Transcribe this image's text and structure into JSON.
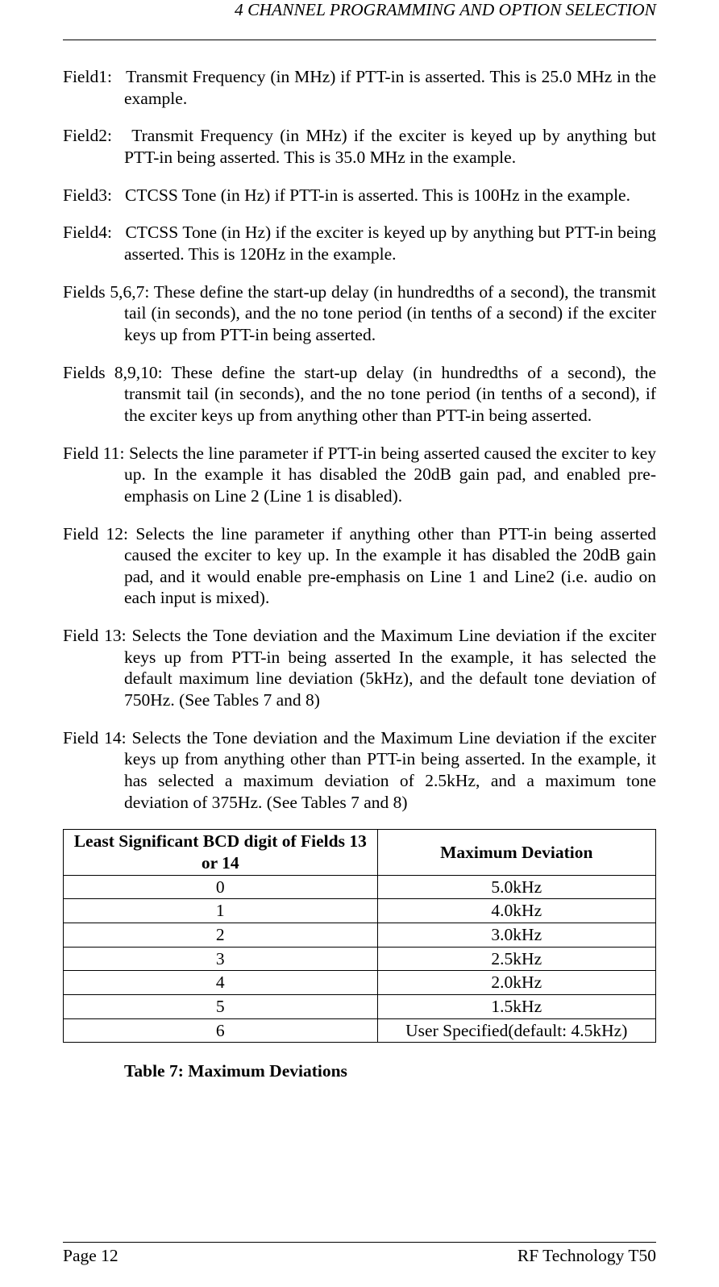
{
  "header": {
    "running": "4  CHANNEL PROGRAMMING AND OPTION SELECTION"
  },
  "fields": {
    "f1_label": "Field1:",
    "f1_text": "Transmit Frequency (in MHz) if PTT-in is asserted.  This is 25.0 MHz in the example.",
    "f2_label": "Field2:",
    "f2_text": "Transmit Frequency (in MHz) if the exciter is keyed up by anything but PTT-in being asserted.  This is 35.0 MHz in the example.",
    "f3_label": "Field3:",
    "f3_text": "CTCSS Tone (in Hz) if PTT-in is asserted.  This is 100Hz in the example.",
    "f4_label": "Field4:",
    "f4_text": "CTCSS Tone (in Hz) if the exciter is keyed up by anything but PTT-in being asserted.  This is 120Hz in the example.",
    "f567_label": "Fields 5,6,7:",
    "f567_text": "These define the start-up delay (in hundredths of a second), the transmit tail (in seconds), and the no tone period (in tenths of a second) if the exciter keys up from PTT-in being asserted.",
    "f8910_label": "Fields 8,9,10:",
    "f8910_text": "These define the start-up delay (in hundredths of a second), the transmit tail (in seconds), and the no tone period (in tenths of a second), if the exciter keys up from anything other than PTT-in being asserted.",
    "f11_label": "Field 11:",
    "f11_text": "Selects the line parameter if PTT-in being asserted caused the exciter to key up.  In the example it has disabled the 20dB gain pad, and enabled pre-emphasis on Line 2 (Line 1 is disabled).",
    "f12_label": "Field 12:",
    "f12_text": "Selects the line parameter if anything other than PTT-in being asserted caused the exciter to key up.  In the example it has disabled the 20dB gain pad, and it would enable pre-emphasis on Line 1 and Line2 (i.e. audio on each input is mixed).",
    "f13_label": "Field 13:",
    "f13_text": "Selects the Tone deviation and the Maximum Line deviation if the exciter keys up from PTT-in being asserted  In the example, it has selected the default maximum line deviation (5kHz), and the default tone deviation of 750Hz. (See Tables 7 and 8)",
    "f14_label": "Field 14:",
    "f14_text": "Selects the Tone deviation and the Maximum Line deviation if the exciter keys up from anything other than PTT-in being asserted.   In the example, it has selected a maximum deviation of 2.5kHz, and a maximum tone deviation of 375Hz. (See Tables 7 and 8)"
  },
  "table7": {
    "head_left": "Least Significant BCD digit of Fields 13 or 14",
    "head_right": "Maximum Deviation",
    "rows": [
      {
        "d": "0",
        "v": "5.0kHz"
      },
      {
        "d": "1",
        "v": "4.0kHz"
      },
      {
        "d": "2",
        "v": "3.0kHz"
      },
      {
        "d": "3",
        "v": "2.5kHz"
      },
      {
        "d": "4",
        "v": "2.0kHz"
      },
      {
        "d": "5",
        "v": "1.5kHz"
      },
      {
        "d": "6",
        "v": "User Specified(default: 4.5kHz)"
      }
    ],
    "caption": "Table 7:  Maximum Deviations"
  },
  "footer": {
    "left": "Page 12",
    "right": "RF Technology T50"
  }
}
